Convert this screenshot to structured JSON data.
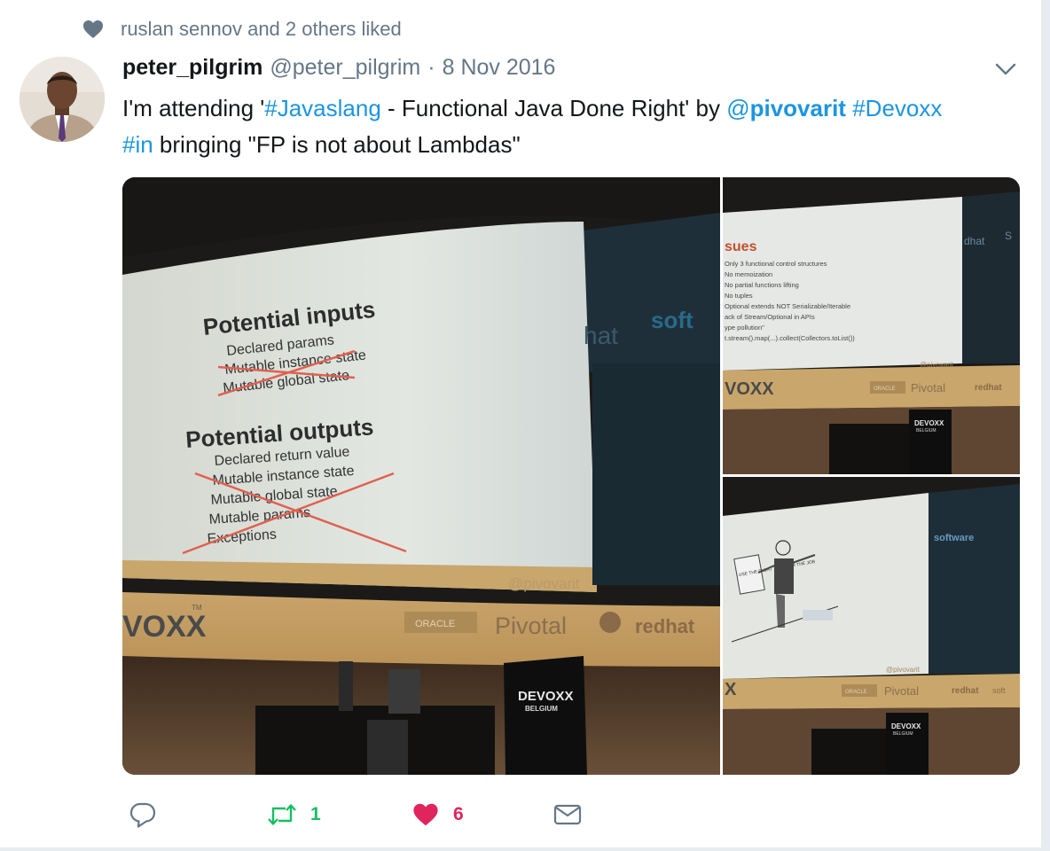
{
  "social_context": {
    "icon": "heart-icon",
    "text": "ruslan sennov and 2 others liked"
  },
  "tweet": {
    "author_name": "peter_pilgrim",
    "author_handle": "@peter_pilgrim",
    "separator": "·",
    "date": "8 Nov 2016",
    "text_parts": {
      "p1": "I'm attending '",
      "hashtag1": "#Javaslang",
      "p2": " - Functional Java Done Right' by ",
      "mention_at": "@",
      "mention_name": "pivovarit",
      "p3": " ",
      "hashtag2": "#Devoxx",
      "p4": " ",
      "hashtag3": "#in",
      "p5": " bringing \"FP is not about Lambdas\""
    }
  },
  "slides": {
    "main": {
      "heading_inputs": "Potential inputs",
      "inputs": [
        "Declared params",
        "Mutable instance state",
        "Mutable global state"
      ],
      "heading_outputs": "Potential outputs",
      "outputs": [
        "Declared return value",
        "Mutable instance state",
        "Mutable global state",
        "Mutable params",
        "Exceptions"
      ],
      "footer_handle": "@pivovarit",
      "banner_devoxx": "VOXX",
      "banner_tm": "TM",
      "sponsor_oracle": "ORACLE",
      "sponsor_pivotal": "Pivotal",
      "sponsor_redhat": "redhat",
      "side_hat": "hat",
      "side_soft": "soft",
      "podium_devoxx": "DEVOXX",
      "podium_belgium": "BELGIUM"
    },
    "top_right": {
      "heading": "sues",
      "items": [
        "Only 3 functional control structures",
        "No memoization",
        "No partial functions lifting",
        "No tuples",
        "Optional extends NOT Serializable/Iterable",
        "ack of Stream/Optional in APIs",
        "ype pollution\"",
        "t.stream().map(...).collect(Collectors.toList())"
      ],
      "footer_handle": "@pivovarit",
      "side_redhat": "dhat",
      "side_s": "S",
      "banner_devoxx": "VOXX",
      "sponsor_oracle": "ORACLE",
      "sponsor_pivotal": "Pivotal",
      "sponsor_redhat": "redhat",
      "podium_devoxx": "DEVOXX",
      "podium_belgium": "BELGIUM"
    },
    "bottom_right": {
      "sign_text": "USE THE RIGHT TOOL FOR THE JOB",
      "footer_handle": "@pivovarit",
      "side_software": "software",
      "banner_devoxx": "X",
      "sponsor_oracle": "ORACLE",
      "sponsor_pivotal": "Pivotal",
      "sponsor_redhat": "redhat",
      "sponsor_soft": "soft",
      "podium_devoxx": "DEVOXX",
      "podium_belgium": "BELGIUM"
    }
  },
  "actions": {
    "reply": {
      "icon": "reply-icon"
    },
    "retweet": {
      "icon": "retweet-icon",
      "count": "1"
    },
    "like": {
      "icon": "heart-icon",
      "count": "6"
    },
    "dm": {
      "icon": "envelope-icon"
    }
  },
  "colors": {
    "link": "#1b95e0",
    "muted": "#657786",
    "retweet_green": "#17bf63",
    "like_red": "#e0245e"
  }
}
